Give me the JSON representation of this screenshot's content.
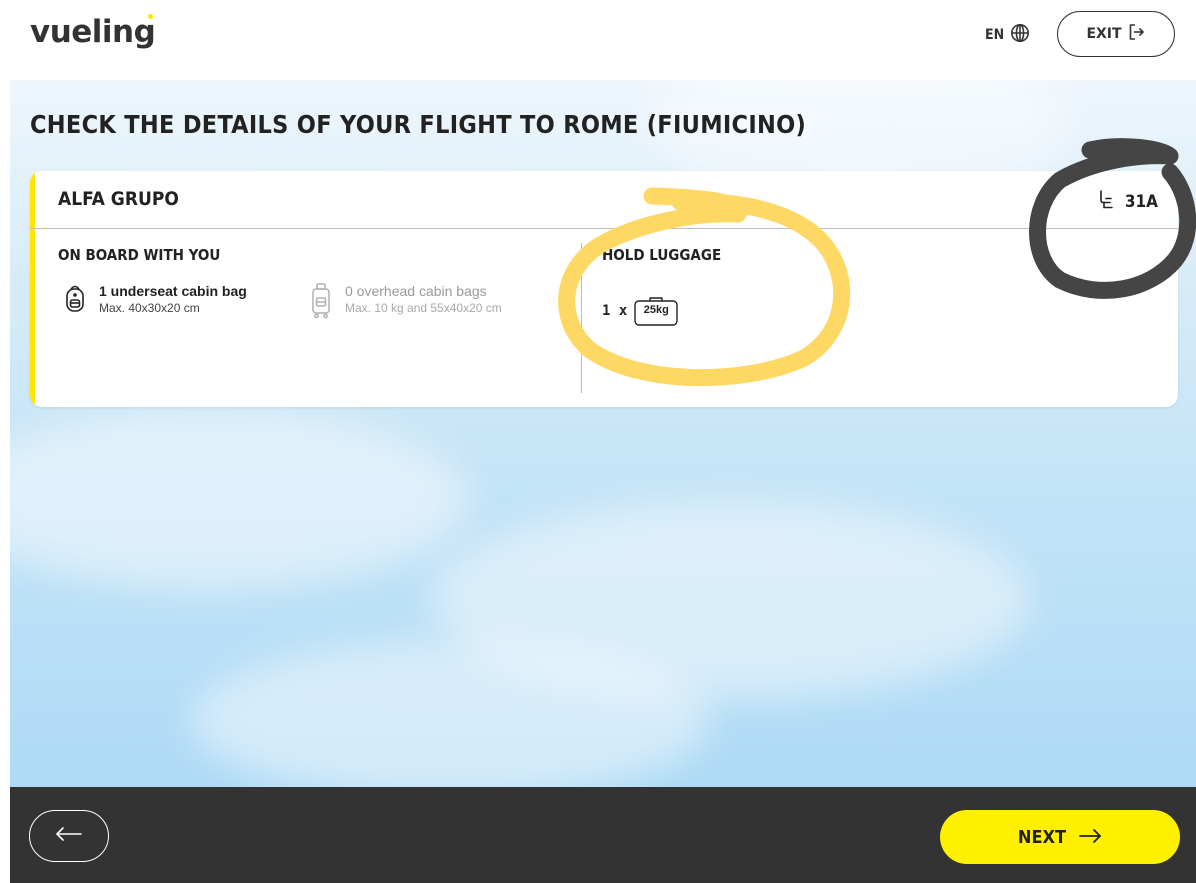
{
  "header": {
    "logo": "vueling",
    "language": "EN",
    "exit_label": "EXIT"
  },
  "main": {
    "title": "CHECK THE DETAILS OF YOUR FLIGHT TO ROME (FIUMICINO)",
    "card": {
      "passenger_name": "ALFA GRUPO",
      "seat": "31A",
      "on_board": {
        "title": "ON BOARD WITH YOU",
        "items": [
          {
            "name": "1 underseat cabin bag",
            "desc": "Max. 40x30x20 cm",
            "icon": "backpack-icon",
            "active": true
          },
          {
            "name": "0 overhead cabin bags",
            "desc": "Max. 10 kg and 55x40x20 cm",
            "icon": "trolley-bag-icon",
            "active": false
          }
        ]
      },
      "hold_luggage": {
        "title": "HOLD LUGGAGE",
        "quantity": "1 x",
        "weight": "25kg",
        "icon": "suitcase-icon"
      }
    }
  },
  "footer": {
    "back_icon": "arrow-left-icon",
    "next_label": "NEXT",
    "next_icon": "arrow-right-icon"
  },
  "colors": {
    "brand_yellow": "#fff000",
    "accent_yellow": "#ffe600",
    "footer_bg": "#333333",
    "text": "#222222",
    "annotation_yellow": "#fdd865",
    "annotation_dark": "#454545"
  }
}
